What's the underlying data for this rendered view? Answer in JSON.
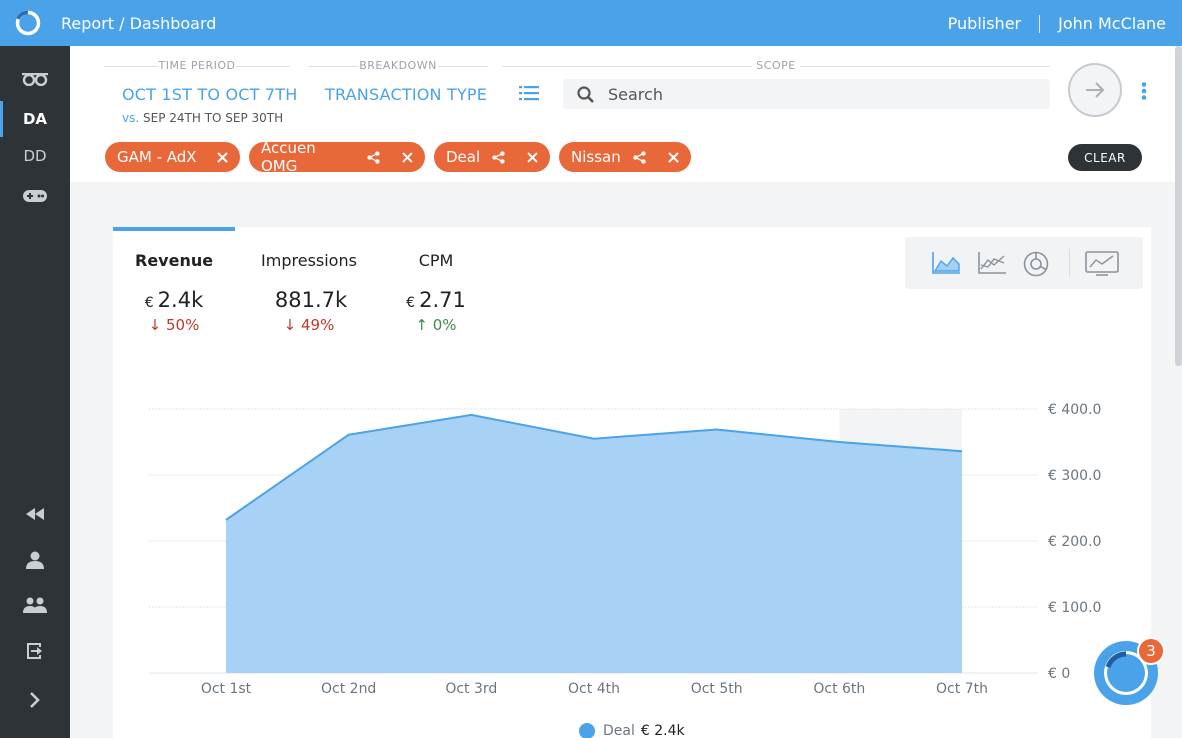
{
  "app": {
    "title": "Report / Dashboard",
    "role": "Publisher",
    "user": "John McClane"
  },
  "sidebar": {
    "items": [
      {
        "icon": "glasses-icon"
      },
      {
        "label": "DA",
        "active": true
      },
      {
        "label": "DD"
      },
      {
        "icon": "gamepad-icon"
      },
      {
        "icon": "rewind-icon"
      },
      {
        "icon": "user-icon"
      },
      {
        "icon": "users-icon"
      },
      {
        "icon": "logout-icon"
      },
      {
        "icon": "chevron-right-icon"
      }
    ]
  },
  "filters": {
    "time_period_label": "TIME PERIOD",
    "time_period_value": "OCT 1ST TO OCT 7TH",
    "compare_prefix": "vs.",
    "compare_value": "SEP 24TH TO SEP 30TH",
    "breakdown_label": "BREAKDOWN",
    "breakdown_value": "TRANSACTION TYPE",
    "scope_label": "SCOPE",
    "search_placeholder": "Search"
  },
  "chips": [
    {
      "label": "GAM - AdX",
      "shareable": false
    },
    {
      "label": "Accuen OMG",
      "shareable": true
    },
    {
      "label": "Deal",
      "shareable": true
    },
    {
      "label": "Nissan",
      "shareable": true
    }
  ],
  "clear_label": "CLEAR",
  "metrics": [
    {
      "label": "Revenue",
      "currency": "€",
      "value": "2.4k",
      "change": "50%",
      "direction": "down",
      "active": true
    },
    {
      "label": "Impressions",
      "currency": "",
      "value": "881.7k",
      "change": "49%",
      "direction": "down"
    },
    {
      "label": "CPM",
      "currency": "€",
      "value": "2.71",
      "change": "0%",
      "direction": "up"
    }
  ],
  "chart_data": {
    "type": "area",
    "x": [
      "Oct 1st",
      "Oct 2nd",
      "Oct 3rd",
      "Oct 4th",
      "Oct 5th",
      "Oct 6th",
      "Oct 7th"
    ],
    "y_ticks": [
      "€ 0",
      "€ 100.0",
      "€ 200.0",
      "€ 300.0",
      "€ 400.0"
    ],
    "ylim": [
      0,
      400
    ],
    "series": [
      {
        "name": "Deal",
        "values": [
          232,
          361,
          391,
          355,
          369,
          350,
          336
        ]
      }
    ],
    "legend": {
      "name": "Deal",
      "total": "€ 2.4k"
    },
    "color": "#4aa3e8",
    "fill": "#a3cff5",
    "grid": true
  },
  "help": {
    "badge_count": "3"
  },
  "colors": {
    "primary": "#4aa3e8",
    "chip": "#e8683a",
    "sidebar": "#2e3338",
    "down": "#c0392b",
    "up": "#3f8a4d"
  }
}
